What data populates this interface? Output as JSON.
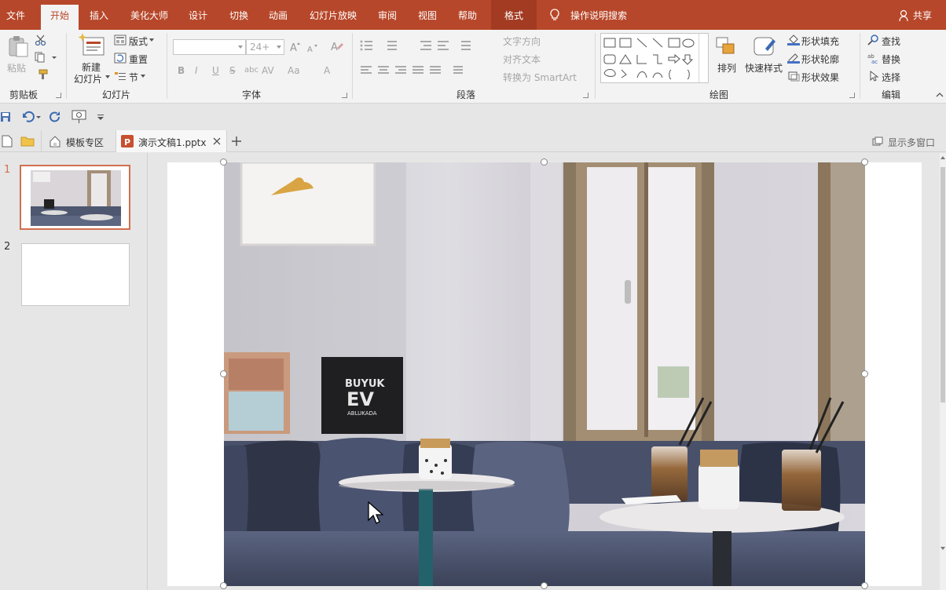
{
  "menu": {
    "tabs": [
      {
        "label": "文件"
      },
      {
        "label": "开始"
      },
      {
        "label": "插入"
      },
      {
        "label": "美化大师"
      },
      {
        "label": "设计"
      },
      {
        "label": "切换"
      },
      {
        "label": "动画"
      },
      {
        "label": "幻灯片放映"
      },
      {
        "label": "审阅"
      },
      {
        "label": "视图"
      },
      {
        "label": "帮助"
      }
    ],
    "format_tab": "格式",
    "tell_me": "操作说明搜索",
    "share": "共享"
  },
  "ribbon": {
    "clipboard": {
      "paste": "粘贴",
      "label": "剪贴板"
    },
    "slides": {
      "new_slide_line1": "新建",
      "new_slide_line2": "幻灯片",
      "layout": "版式",
      "reset": "重置",
      "section": "节",
      "label": "幻灯片"
    },
    "font": {
      "size": "24+",
      "bold": "B",
      "italic": "I",
      "underline": "U",
      "strike": "S",
      "shadow": "abc",
      "spacing": "AV",
      "case": "Aa",
      "color": "A",
      "label": "字体"
    },
    "paragraph": {
      "text_direction": "文字方向",
      "align_text": "对齐文本",
      "smartart": "转换为 SmartArt",
      "label": "段落"
    },
    "drawing": {
      "arrange": "排列",
      "quick_styles": "快速样式",
      "shape_fill": "形状填充",
      "shape_outline": "形状轮廓",
      "shape_effects": "形状效果",
      "label": "绘图"
    },
    "editing": {
      "find": "查找",
      "replace": "替换",
      "select": "选择",
      "label": "编辑"
    }
  },
  "tabbar": {
    "template_zone": "模板专区",
    "doc_name": "演示文稿1.pptx",
    "multi_window": "显示多窗口"
  },
  "thumbnails": [
    {
      "number": "1",
      "selected": true
    },
    {
      "number": "2",
      "selected": false
    }
  ],
  "slide_picture": {
    "poster_text_1": "BUYUK",
    "poster_text_2": "EV",
    "poster_text_3": "ABLUKADA"
  },
  "colors": {
    "accent": "#b7472a",
    "selection": "#d0704f"
  }
}
